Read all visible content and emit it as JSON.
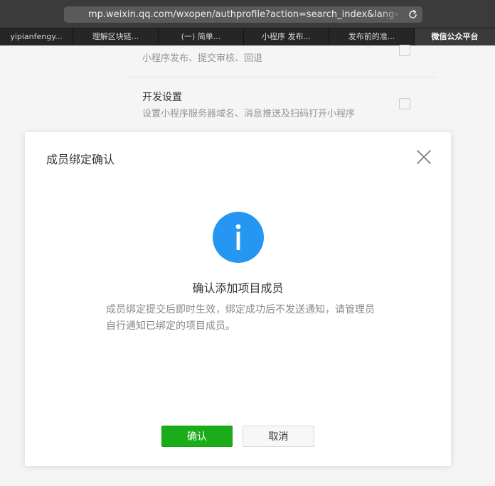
{
  "browser": {
    "url": "mp.weixin.qq.com/wxopen/authprofile?action=search_index&lang=zh_CN&tok",
    "tabs": [
      {
        "label": "yipianfengy..."
      },
      {
        "label": "理解区块链..."
      },
      {
        "label": "(一) 简单..."
      },
      {
        "label": "小程序 发布..."
      },
      {
        "label": "发布前的准..."
      },
      {
        "label": "微信公众平台",
        "active": true
      }
    ]
  },
  "page": {
    "permissions": [
      {
        "title": "",
        "desc": "小程序发布、提交审核、回退"
      },
      {
        "title": "开发设置",
        "desc": "设置小程序服务器域名、消息推送及扫码打开小程序"
      }
    ]
  },
  "dialog": {
    "title": "成员绑定确认",
    "heading": "确认添加项目成员",
    "description": "成员绑定提交后即时生效，绑定成功后不发送通知，请管理员自行通知已绑定的项目成员。",
    "confirm_label": "确认",
    "cancel_label": "取消"
  },
  "colors": {
    "primary_green": "#1aad19",
    "info_blue": "#2597f2"
  },
  "icons": [
    "reload-icon",
    "close-icon",
    "info-icon"
  ]
}
